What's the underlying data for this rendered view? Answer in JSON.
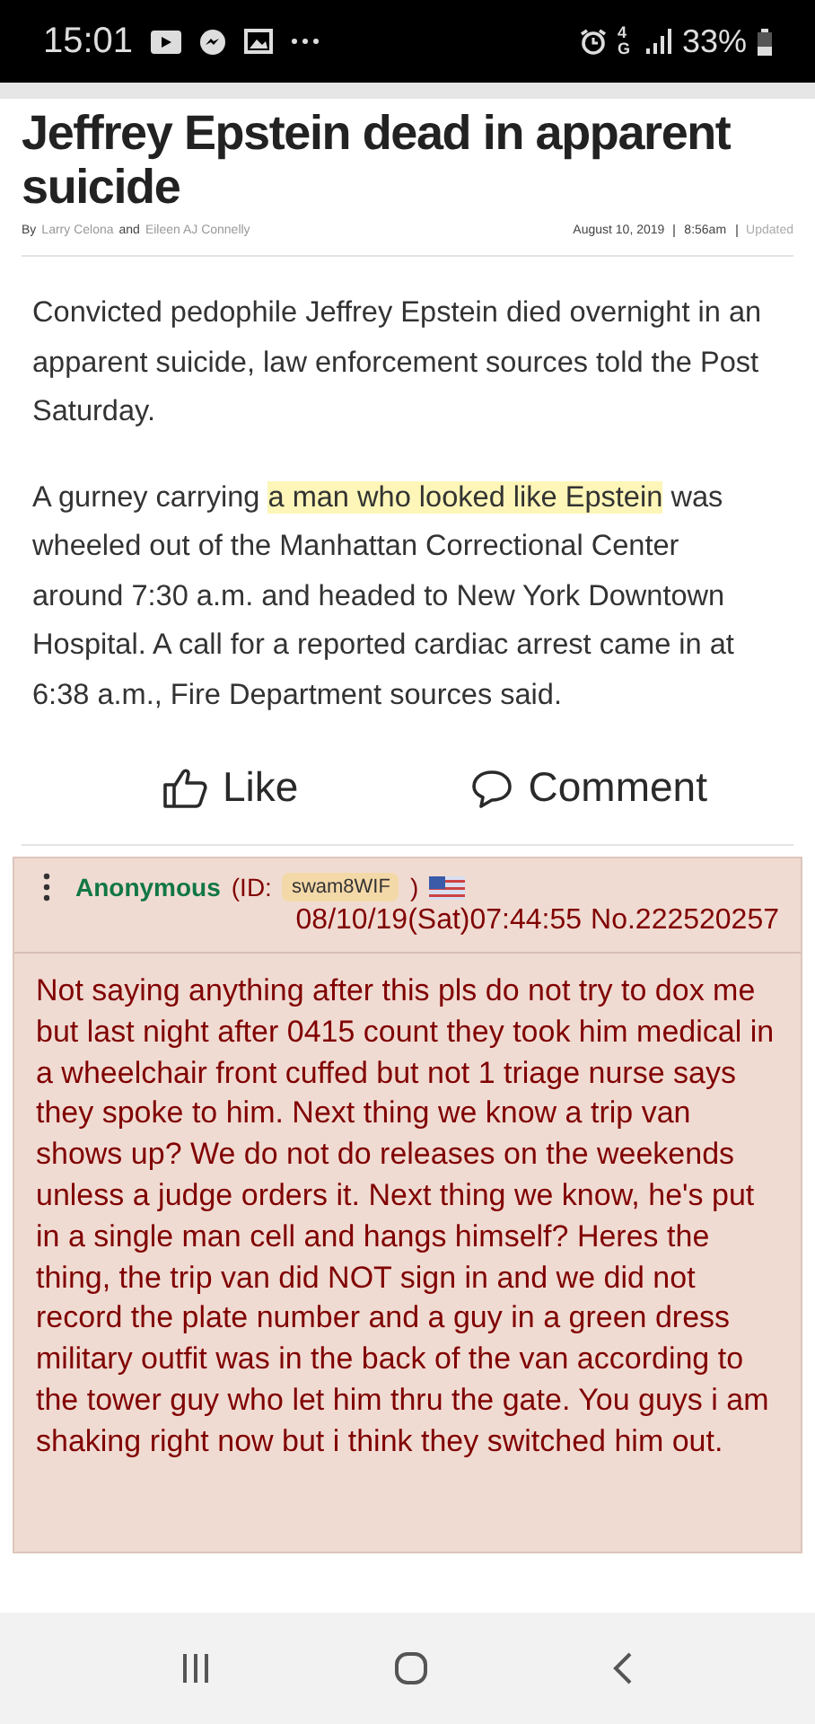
{
  "status_bar": {
    "time": "15:01",
    "network": "4G",
    "battery": "33%"
  },
  "article": {
    "title": "Jeffrey Epstein dead in apparent suicide",
    "byline_prefix": "By",
    "author_1": "Larry Celona",
    "byline_and": "and",
    "author_2": "Eileen AJ Connelly",
    "date": "August 10, 2019",
    "time": "8:56am",
    "updated": "Updated",
    "paragraphs": [
      [
        {
          "text": "Convicted pedophile Jeffrey Epstein died overnight in an apparent suicide, law enforcement sources told the Post Saturday.",
          "highlighted": false
        }
      ],
      [
        {
          "text": "A gurney carrying ",
          "highlighted": false
        },
        {
          "text": "a man who looked like Epstein",
          "highlighted": true
        },
        {
          "text": " was wheeled out of the Manhattan Correctional Center around 7:30 a.m. and headed to New York Downtown Hospital. A call for a reported cardiac arrest came in at 6:38 a.m., Fire Department sources said.",
          "highlighted": false
        }
      ]
    ]
  },
  "actions": [
    {
      "kind": "like",
      "label": "Like"
    },
    {
      "kind": "comment",
      "label": "Comment"
    }
  ],
  "post": {
    "name": "Anonymous",
    "id_prefix": "(ID:",
    "id": "swam8WIF",
    "id_suffix": ")",
    "datetime": "08/10/19(Sat)07:44:55",
    "number": "No.222520257",
    "text": "Not saying anything after this pls do not try to dox me but last night after 0415 count they took him medical in a wheelchair front cuffed but not 1 triage nurse says they spoke to him. Next thing we know a trip van shows up? We do not do releases on the weekends unless a judge orders it. Next thing we know, he's put in a single man cell and hangs himself? Heres the thing, the trip van did NOT sign in and we did not record the plate number and a guy in a green dress military outfit was in the back of the van according to the tower guy who let him thru the gate. You guys i am shaking right now but i think they switched him out."
  }
}
